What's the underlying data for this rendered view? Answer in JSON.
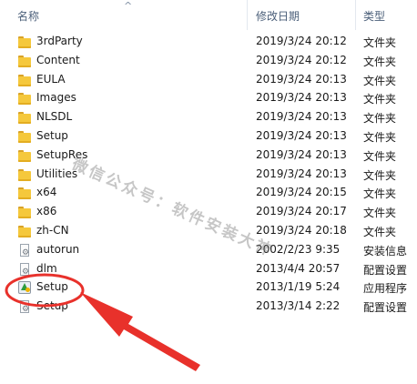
{
  "header": {
    "name_label": "名称",
    "date_label": "修改日期",
    "type_label": "类型",
    "sort_glyph": "^"
  },
  "rows": [
    {
      "icon": "folder-icon",
      "name": "3rdParty",
      "date": "2019/3/24 20:12",
      "type": "文件夹"
    },
    {
      "icon": "folder-icon",
      "name": "Content",
      "date": "2019/3/24 20:12",
      "type": "文件夹"
    },
    {
      "icon": "folder-icon",
      "name": "EULA",
      "date": "2019/3/24 20:13",
      "type": "文件夹"
    },
    {
      "icon": "folder-icon",
      "name": "Images",
      "date": "2019/3/24 20:13",
      "type": "文件夹"
    },
    {
      "icon": "folder-icon",
      "name": "NLSDL",
      "date": "2019/3/24 20:13",
      "type": "文件夹"
    },
    {
      "icon": "folder-icon",
      "name": "Setup",
      "date": "2019/3/24 20:13",
      "type": "文件夹"
    },
    {
      "icon": "folder-icon",
      "name": "SetupRes",
      "date": "2019/3/24 20:13",
      "type": "文件夹"
    },
    {
      "icon": "folder-icon",
      "name": "Utilities",
      "date": "2019/3/24 20:13",
      "type": "文件夹"
    },
    {
      "icon": "folder-icon",
      "name": "x64",
      "date": "2019/3/24 20:15",
      "type": "文件夹"
    },
    {
      "icon": "folder-icon",
      "name": "x86",
      "date": "2019/3/24 20:17",
      "type": "文件夹"
    },
    {
      "icon": "folder-icon",
      "name": "zh-CN",
      "date": "2019/3/24 20:18",
      "type": "文件夹"
    },
    {
      "icon": "settings-file-icon",
      "name": "autorun",
      "date": "2002/2/23 9:35",
      "type": "安装信息"
    },
    {
      "icon": "settings-file-icon",
      "name": "dlm",
      "date": "2013/4/4 20:57",
      "type": "配置设置"
    },
    {
      "icon": "setup-app-icon",
      "name": "Setup",
      "date": "2013/1/19 5:24",
      "type": "应用程序"
    },
    {
      "icon": "settings-file-icon",
      "name": "Setup",
      "date": "2013/3/14 2:22",
      "type": "配置设置"
    }
  ],
  "watermark": "微信公众号：软件安装大神",
  "colors": {
    "annotation": "#e8312b",
    "header_text": "#4c607a",
    "folder": "#f5c83c"
  }
}
